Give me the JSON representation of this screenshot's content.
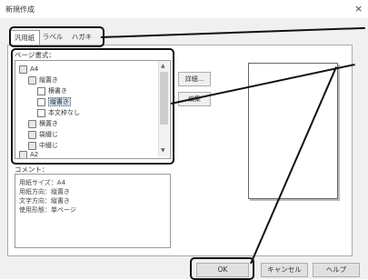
{
  "dialog": {
    "title": "新規作成",
    "close_glyph": "×",
    "tabs": [
      {
        "label": "汎用紙",
        "active": true
      },
      {
        "label": "ラベル",
        "active": false
      },
      {
        "label": "ハガキ",
        "active": false
      }
    ],
    "page_format_label": "ページ書式：",
    "tree": [
      {
        "label": "A4",
        "icon": "collapse-icon"
      },
      {
        "label": "縦置き",
        "icon": "collapse-icon"
      },
      {
        "label": "横書き",
        "icon": "page-icon"
      },
      {
        "label": "縦書き",
        "icon": "page-icon",
        "selected": true
      },
      {
        "label": "本文枠なし",
        "icon": "page-icon"
      },
      {
        "label": "横置き",
        "icon": "expand-icon"
      },
      {
        "label": "袋綴じ",
        "icon": "expand-icon"
      },
      {
        "label": "中綴じ",
        "icon": "expand-icon"
      },
      {
        "label": "A2",
        "icon": "expand-icon"
      }
    ],
    "detail_button": "詳細...",
    "edit_button": "編集",
    "comment_label": "コメント：",
    "comment_lines": [
      "用紙サイズ：A4",
      "用紙方向：縦置き",
      "文字方向：縦書き",
      "使用形態：単ページ"
    ],
    "ok_button": "OK",
    "cancel_button": "キャンセル",
    "help_button": "ヘルプ"
  }
}
